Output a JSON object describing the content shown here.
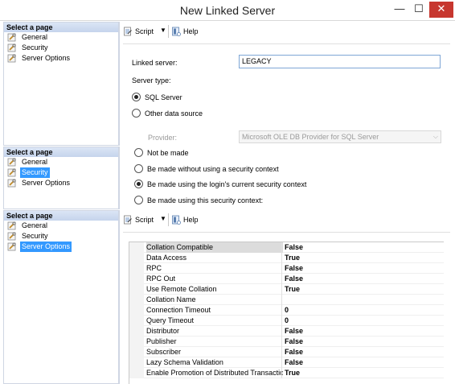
{
  "window": {
    "title": "New Linked Server",
    "minimize_glyph": "—",
    "maximize_glyph": "☐",
    "close_glyph": "✕"
  },
  "icons": {
    "page": "wrench-page-icon",
    "script": "script-icon",
    "help": "help-icon"
  },
  "colors": {
    "selection": "#3399ff",
    "pane_header": "#c5d4ec",
    "close_button": "#c7372f"
  },
  "pane1": {
    "header": "Select a page",
    "items": [
      {
        "label": "General",
        "selected": false
      },
      {
        "label": "Security",
        "selected": false
      },
      {
        "label": "Server Options",
        "selected": false
      }
    ]
  },
  "pane2": {
    "header": "Select a page",
    "items": [
      {
        "label": "General",
        "selected": false
      },
      {
        "label": "Security",
        "selected": true
      },
      {
        "label": "Server Options",
        "selected": false
      }
    ]
  },
  "pane3": {
    "header": "Select a page",
    "items": [
      {
        "label": "General",
        "selected": false
      },
      {
        "label": "Security",
        "selected": false
      },
      {
        "label": "Server Options",
        "selected": true
      }
    ]
  },
  "toolbar": {
    "script_label": "Script",
    "dropdown_glyph": "▼",
    "help_label": "Help"
  },
  "general": {
    "linked_server_label": "Linked server:",
    "linked_server_value": "LEGACY",
    "server_type_label": "Server type:",
    "sql_server_label": "SQL Server",
    "sql_server_checked": true,
    "other_source_label": "Other data source",
    "other_source_checked": false,
    "provider_label": "Provider:",
    "provider_value": "Microsoft OLE DB Provider for SQL Server",
    "provider_arrow": "⌵"
  },
  "security": {
    "options": [
      {
        "label": "Not be made",
        "checked": false
      },
      {
        "label": "Be made without using a security context",
        "checked": false
      },
      {
        "label": "Be made using the login's current security context",
        "checked": true
      },
      {
        "label": "Be made using this security context:",
        "checked": false
      }
    ]
  },
  "server_options": {
    "rows": [
      {
        "name": "Collation Compatible",
        "value": "False"
      },
      {
        "name": "Data Access",
        "value": "True"
      },
      {
        "name": "RPC",
        "value": "False"
      },
      {
        "name": "RPC Out",
        "value": "False"
      },
      {
        "name": "Use Remote Collation",
        "value": "True"
      },
      {
        "name": "Collation Name",
        "value": ""
      },
      {
        "name": "Connection Timeout",
        "value": "0"
      },
      {
        "name": "Query Timeout",
        "value": "0"
      },
      {
        "name": "Distributor",
        "value": "False"
      },
      {
        "name": "Publisher",
        "value": "False"
      },
      {
        "name": "Subscriber",
        "value": "False"
      },
      {
        "name": "Lazy Schema Validation",
        "value": "False"
      },
      {
        "name": "Enable Promotion of Distributed Transaction",
        "value": "True"
      }
    ]
  }
}
